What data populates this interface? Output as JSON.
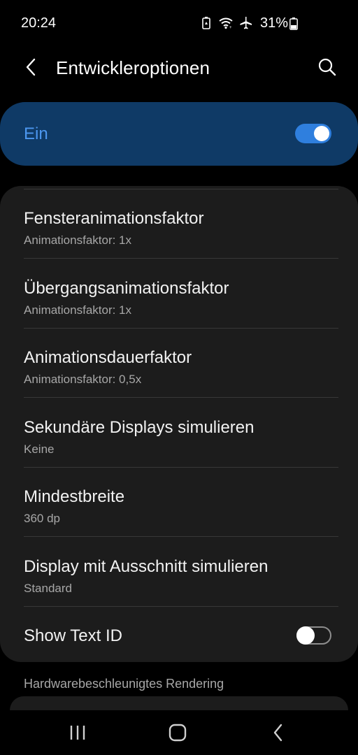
{
  "status_bar": {
    "time": "20:24",
    "battery_percent": "31%",
    "icons": [
      "battery-saver-icon",
      "wifi-icon",
      "airplane-mode-icon",
      "battery-icon"
    ]
  },
  "header": {
    "title": "Entwickleroptionen",
    "back_icon": "back-arrow-icon",
    "search_icon": "search-icon"
  },
  "master_switch": {
    "label": "Ein",
    "state": "on",
    "accent_color": "#4c97f0",
    "background_color": "#0f3a66"
  },
  "settings": [
    {
      "title": "Fensteranimationsfaktor",
      "subtitle": "Animationsfaktor: 1x"
    },
    {
      "title": "Übergangsanimationsfaktor",
      "subtitle": "Animationsfaktor: 1x"
    },
    {
      "title": "Animationsdauerfaktor",
      "subtitle": "Animationsfaktor: 0,5x"
    },
    {
      "title": "Sekundäre Displays simulieren",
      "subtitle": "Keine"
    },
    {
      "title": "Mindestbreite",
      "subtitle": "360 dp"
    },
    {
      "title": "Display mit Ausschnitt simulieren",
      "subtitle": "Standard"
    }
  ],
  "show_text_id": {
    "title": "Show Text ID",
    "state": "off"
  },
  "section_header": "Hardwarebeschleunigtes Rendering",
  "nav_bar": {
    "icons": [
      "recent-apps-icon",
      "home-icon",
      "back-icon"
    ]
  }
}
